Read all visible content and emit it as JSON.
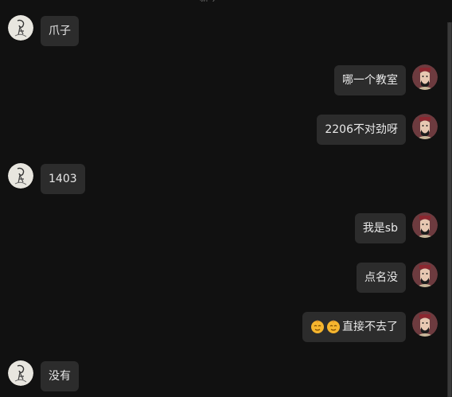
{
  "top_fragment": "新今",
  "messages": [
    {
      "side": "left",
      "text": "爪子",
      "avatar": "sketch-avatar"
    },
    {
      "side": "right",
      "text": "哪一个教室",
      "avatar": "portrait-avatar"
    },
    {
      "side": "right",
      "text": "2206不对劲呀",
      "avatar": "portrait-avatar"
    },
    {
      "side": "left",
      "text": "1403",
      "avatar": "sketch-avatar"
    },
    {
      "side": "right",
      "text": "我是sb",
      "avatar": "portrait-avatar"
    },
    {
      "side": "right",
      "text": "点名没",
      "avatar": "portrait-avatar"
    },
    {
      "side": "right",
      "text": "直接不去了",
      "emojis": [
        "smug-face-emoji",
        "smug-face-emoji"
      ],
      "avatar": "portrait-avatar"
    },
    {
      "side": "left",
      "text": "没有",
      "avatar": "sketch-avatar"
    }
  ]
}
